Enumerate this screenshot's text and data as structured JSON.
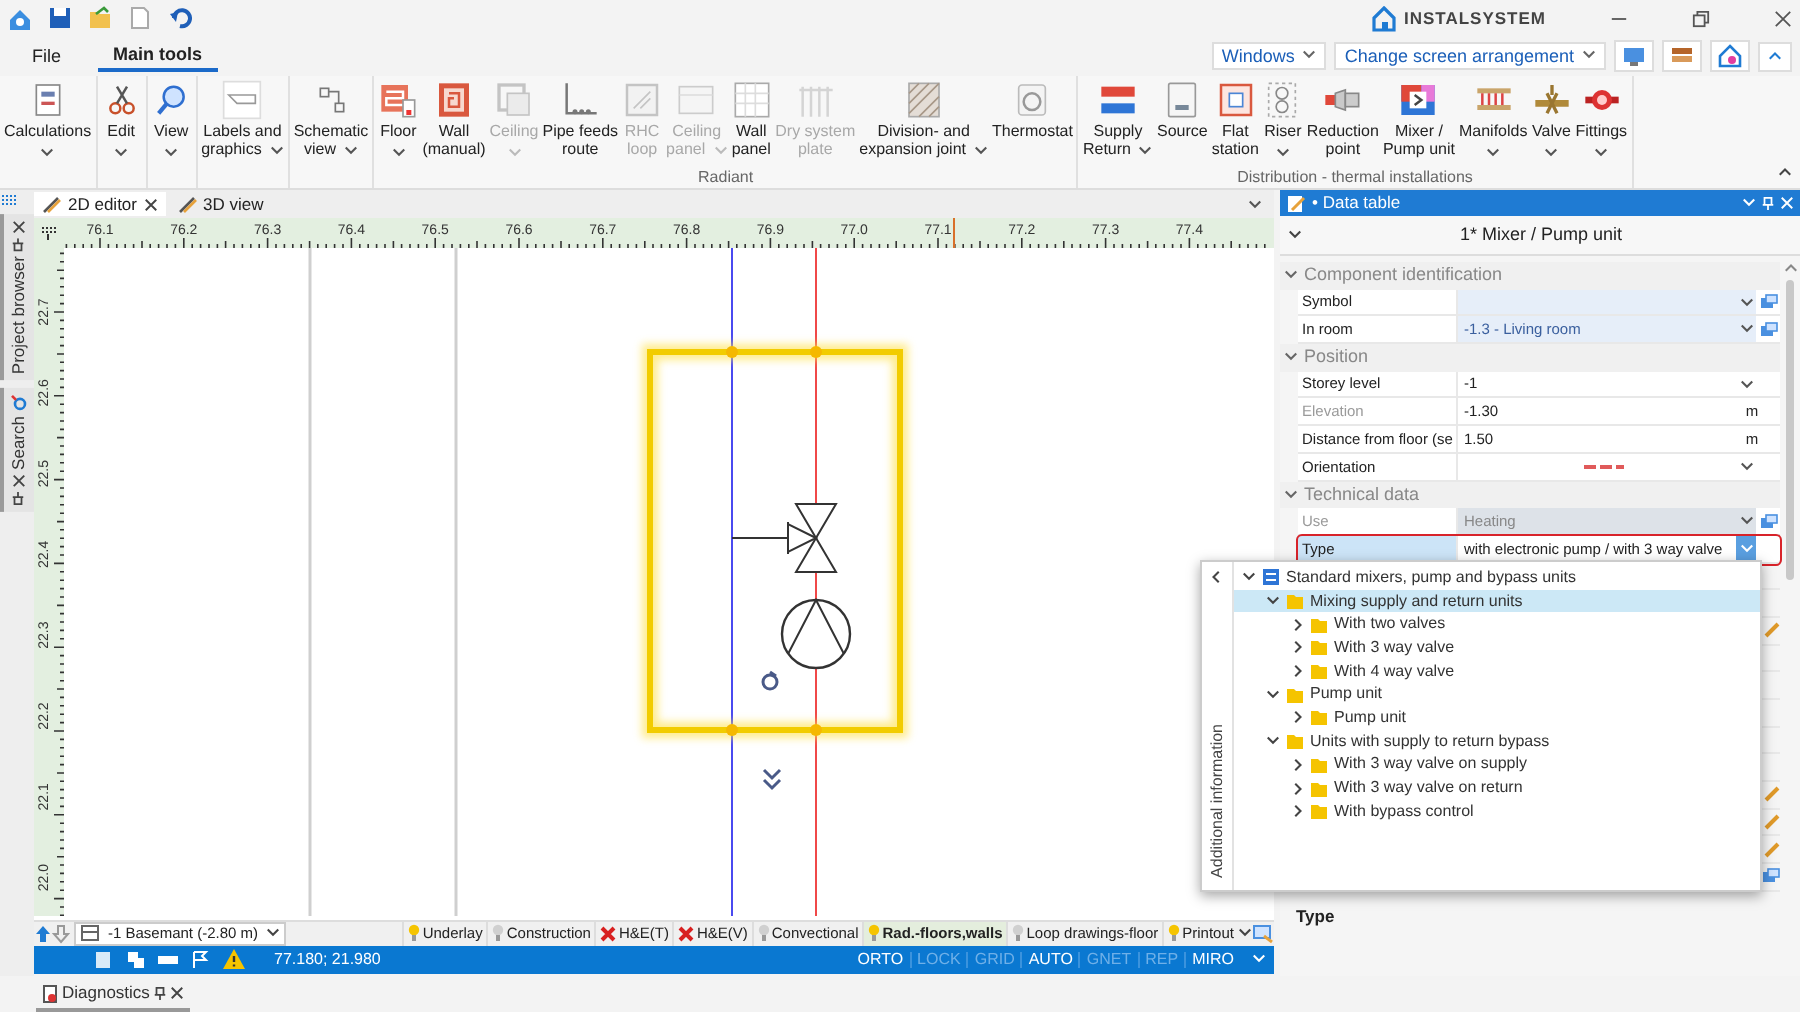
{
  "app": {
    "logo": "INSTALSYSTEM"
  },
  "ribbon": {
    "tabs": [
      {
        "label": "File",
        "selected": false
      },
      {
        "label": "Main tools",
        "selected": true
      }
    ],
    "windows_menu": "Windows",
    "arrangement_menu": "Change screen arrangement",
    "groups": [
      {
        "buttons": [
          {
            "label": "Calculations",
            "dropdown": true,
            "disabled": false
          }
        ]
      },
      {
        "buttons": [
          {
            "label": "Edit",
            "dropdown": true,
            "disabled": false
          }
        ]
      },
      {
        "buttons": [
          {
            "label": "View",
            "dropdown": true,
            "disabled": false
          }
        ]
      },
      {
        "buttons": [
          {
            "label": "Labels and\ngraphics",
            "dropdown": true,
            "disabled": false
          }
        ]
      },
      {
        "buttons": [
          {
            "label": "Schematic\nview",
            "dropdown": true,
            "disabled": false
          }
        ]
      },
      {
        "label": "Radiant",
        "buttons": [
          {
            "label": "Floor",
            "dropdown": true,
            "disabled": false
          },
          {
            "label": "Wall\n(manual)",
            "dropdown": false,
            "disabled": false
          },
          {
            "label": "Ceiling",
            "dropdown": true,
            "disabled": true
          },
          {
            "label": "Pipe feeds\nroute",
            "dropdown": false,
            "disabled": false
          },
          {
            "label": "RHC\nloop",
            "dropdown": false,
            "disabled": true
          },
          {
            "label": "Ceiling\npanel",
            "dropdown": true,
            "disabled": true
          },
          {
            "label": "Wall\npanel",
            "dropdown": false,
            "disabled": false
          },
          {
            "label": "Dry system\nplate",
            "dropdown": false,
            "disabled": true
          },
          {
            "label": "Division- and\nexpansion joint",
            "dropdown": true,
            "disabled": false
          },
          {
            "label": "Thermostat",
            "dropdown": false,
            "disabled": false
          }
        ]
      },
      {
        "label": "Distribution - thermal installations",
        "buttons": [
          {
            "label": "Supply\nReturn",
            "dropdown": true,
            "disabled": false
          },
          {
            "label": "Source",
            "dropdown": false,
            "disabled": false
          },
          {
            "label": "Flat\nstation",
            "dropdown": false,
            "disabled": false
          },
          {
            "label": "Riser",
            "dropdown": true,
            "disabled": false
          },
          {
            "label": "Reduction\npoint",
            "dropdown": false,
            "disabled": false
          },
          {
            "label": "Mixer /\nPump unit",
            "dropdown": false,
            "disabled": false
          },
          {
            "label": "Manifolds",
            "dropdown": true,
            "disabled": false
          },
          {
            "label": "Valve",
            "dropdown": true,
            "disabled": false
          },
          {
            "label": "Fittings",
            "dropdown": true,
            "disabled": false
          }
        ]
      }
    ]
  },
  "side_tabs": [
    {
      "label": "Project browser"
    },
    {
      "label": "Search"
    }
  ],
  "editor": {
    "tabs": [
      {
        "label": "2D editor",
        "selected": true
      },
      {
        "label": "3D view",
        "selected": false
      }
    ],
    "x_ticks": [
      "76.1",
      "76.2",
      "76.3",
      "76.4",
      "76.5",
      "76.6",
      "76.7",
      "76.8",
      "76.9",
      "77.0",
      "77.1",
      "77.2",
      "77.3",
      "77.4"
    ],
    "y_ticks": [
      "22.7",
      "22.6",
      "22.5",
      "22.4",
      "22.3",
      "22.2",
      "22.1",
      "22.0"
    ],
    "storey": "-1 Basemant (-2.80 m)",
    "layers": [
      {
        "label": "Underlay",
        "kind": "lit",
        "selected": false
      },
      {
        "label": "Construction",
        "kind": "unlit",
        "selected": false
      },
      {
        "label": "H&E(T)",
        "kind": "crossed",
        "selected": false
      },
      {
        "label": "H&E(V)",
        "kind": "crossed",
        "selected": false
      },
      {
        "label": "Convectional",
        "kind": "unlit",
        "selected": false
      },
      {
        "label": "Rad.-floors,walls",
        "kind": "lit",
        "selected": true
      },
      {
        "label": "Loop drawings-floor",
        "kind": "unlit",
        "selected": false
      },
      {
        "label": "Printout",
        "kind": "lit",
        "selected": false
      }
    ],
    "coordinates": "77.180; 21.980",
    "modes": [
      {
        "label": "ORTO",
        "on": true
      },
      {
        "label": "LOCK",
        "on": false
      },
      {
        "label": "GRID",
        "on": false
      },
      {
        "label": "AUTO",
        "on": true
      },
      {
        "label": "GNET",
        "on": false
      },
      {
        "label": "REP",
        "on": false
      },
      {
        "label": "MIRO",
        "on": true
      }
    ]
  },
  "data_table": {
    "title": "• Data table",
    "subtitle": "1* Mixer / Pump unit",
    "sections": [
      {
        "title": "Component identification",
        "expanded": true,
        "rows": [
          {
            "label": "Symbol",
            "kind": "linked",
            "disabled": false,
            "selected": false
          },
          {
            "label": "In room",
            "value": "-1.3 - Living room",
            "kind": "linked",
            "disabled": false,
            "selected": false
          }
        ]
      },
      {
        "title": "Position",
        "expanded": true,
        "rows": [
          {
            "label": "Storey level",
            "value": "-1",
            "kind": "dropdown",
            "disabled": false,
            "selected": false
          },
          {
            "label": "Elevation",
            "value": "-1.30",
            "unit": "m",
            "kind": "number",
            "disabled": true,
            "selected": false
          },
          {
            "label": "Distance from floor (se",
            "value": "1.50",
            "unit": "m",
            "kind": "number",
            "disabled": false,
            "selected": false
          },
          {
            "label": "Orientation",
            "kind": "orientation",
            "disabled": false,
            "selected": false
          }
        ]
      },
      {
        "title": "Technical data",
        "expanded": true,
        "rows": [
          {
            "label": "Use",
            "value": "Heating",
            "kind": "linked",
            "disabled": true,
            "selected": false
          },
          {
            "label": "Type",
            "value": "with electronic pump / with 3 way valve",
            "kind": "dropdown",
            "disabled": false,
            "selected": true
          }
        ]
      }
    ],
    "description": "Type"
  },
  "type_picker": {
    "side_label": "Additional information",
    "tree": [
      {
        "label": "Standard mixers, pump and bypass units",
        "kind": "root",
        "expanded": true,
        "selected": false,
        "children": [
          {
            "label": "Mixing supply and return units",
            "kind": "folder",
            "expanded": true,
            "selected": true,
            "children": [
              {
                "label": "With two valves",
                "kind": "folder",
                "expanded": false,
                "selected": false
              },
              {
                "label": "With 3 way valve",
                "kind": "folder",
                "expanded": false,
                "selected": false
              },
              {
                "label": "With 4 way valve",
                "kind": "folder",
                "expanded": false,
                "selected": false
              }
            ]
          },
          {
            "label": "Pump unit",
            "kind": "folder",
            "expanded": true,
            "selected": false,
            "children": [
              {
                "label": "Pump unit",
                "kind": "folder",
                "expanded": false,
                "selected": false
              }
            ]
          },
          {
            "label": "Units with supply to return bypass",
            "kind": "folder",
            "expanded": true,
            "selected": false,
            "children": [
              {
                "label": "With 3 way valve on supply",
                "kind": "folder",
                "expanded": false,
                "selected": false
              },
              {
                "label": "With 3 way valve on return",
                "kind": "folder",
                "expanded": false,
                "selected": false
              },
              {
                "label": "With bypass control",
                "kind": "folder",
                "expanded": false,
                "selected": false
              }
            ]
          }
        ]
      }
    ]
  },
  "bottom_tabs": [
    {
      "label": "Diagnostics"
    }
  ]
}
